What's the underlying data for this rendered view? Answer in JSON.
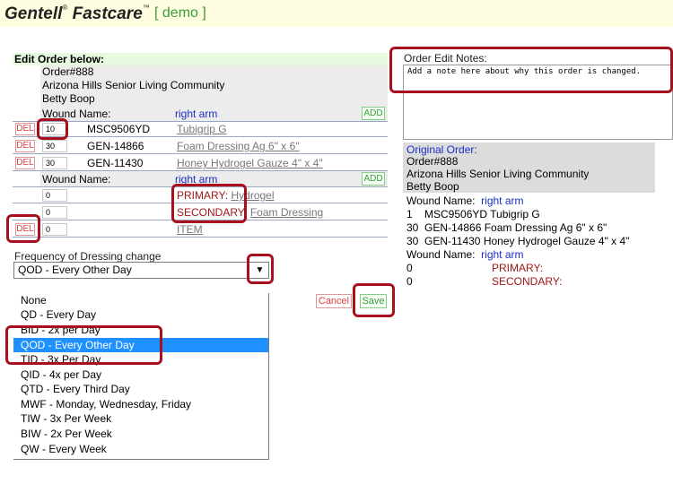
{
  "header": {
    "brand": "Gentell",
    "brand_mark": "®",
    "product": "Fastcare",
    "product_mark": "™",
    "env": "[ demo ]"
  },
  "edit": {
    "heading": "Edit Order below:",
    "order_no": "Order#888",
    "facility": "Arizona Hills Senior Living Community",
    "patient": "Betty Boop",
    "wound1": {
      "label": "Wound Name:",
      "name": "right arm",
      "add_label": "ADD",
      "items": [
        {
          "del": "DEL",
          "qty": "10",
          "sku": "MSC9506YD",
          "desc": "Tubigrip G"
        },
        {
          "del": "DEL",
          "qty": "30",
          "sku": "GEN-14866",
          "desc": "Foam Dressing Ag 6\" x 6\""
        },
        {
          "del": "DEL",
          "qty": "30",
          "sku": "GEN-11430",
          "desc": "Honey Hydrogel Gauze 4\" x 4\""
        }
      ]
    },
    "wound2": {
      "label": "Wound Name:",
      "name": "right arm",
      "add_label": "ADD",
      "primary_qty": "0",
      "primary_label": "PRIMARY:",
      "primary_value": "Hydrogel",
      "secondary_qty": "0",
      "secondary_label": "SECONDARY:",
      "secondary_value": "Foam Dressing",
      "item_del": "DEL",
      "item_qty": "0",
      "item_label": "ITEM"
    },
    "frequency": {
      "label": "Frequency of Dressing change",
      "selected": "QOD - Every Other Day",
      "arrow": "▼",
      "options": [
        "None",
        "QD - Every Day",
        "BID - 2x per Day",
        "QOD - Every Other Day",
        "TID - 3x Per Day",
        "QID - 4x per Day",
        "QTD - Every Third Day",
        "MWF - Monday, Wednesday, Friday",
        "TIW - 3x Per Week",
        "BIW - 2x Per Week",
        "QW - Every Week"
      ],
      "highlighted_index": 3
    },
    "cancel_label": "Cancel",
    "save_label": "Save"
  },
  "notes": {
    "label": "Order Edit Notes:",
    "placeholder": "Add a note here about why this order is changed."
  },
  "original": {
    "title": "Original Order:",
    "order_no": "Order#888",
    "facility": "Arizona Hills Senior Living Community",
    "patient": "Betty Boop",
    "wound_label": "Wound Name:",
    "wound_name": "right arm",
    "items": [
      {
        "qty": "1",
        "sku": "MSC9506YD",
        "desc": "Tubigrip G"
      },
      {
        "qty": "30",
        "sku": "GEN-14866",
        "desc": "Foam Dressing Ag 6\" x 6\""
      },
      {
        "qty": "30",
        "sku": "GEN-11430",
        "desc": "Honey Hydrogel Gauze 4\" x 4\""
      }
    ],
    "wound2_label": "Wound Name:",
    "wound2_name": "right arm",
    "primary_qty": "0",
    "primary_label": "PRIMARY:",
    "secondary_qty": "0",
    "secondary_label": "SECONDARY:"
  },
  "colors": {
    "highlight_red": "#a8101e",
    "selected_option": "#1e90ff",
    "link_blue": "#1a2ec8",
    "demo_green": "#3a9b3a"
  }
}
